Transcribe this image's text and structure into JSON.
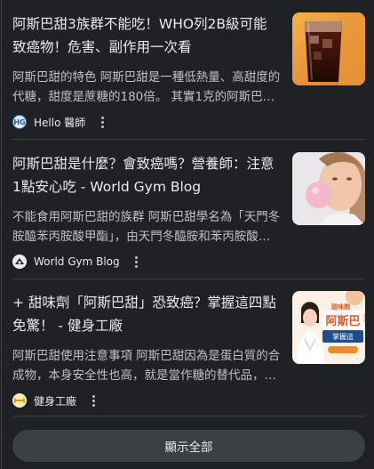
{
  "articles": [
    {
      "title": "阿斯巴甜3族群不能吃！WHO列2B級可能致癌物！危害、副作用一次看",
      "snippet": "阿斯巴甜的特色 阿斯巴甜是一種低熱量、高甜度的代糖，甜度是蔗糖的180倍。 其實1克的阿斯巴甜…",
      "source": "Hello 醫師",
      "favicon_text": "HG",
      "thumb_icon": "soda-glass-image"
    },
    {
      "title": "阿斯巴甜是什麼？會致癌嗎？營養師：注意1點安心吃 - World Gym Blog",
      "snippet": "不能食用阿斯巴甜的族群 阿斯巴甜學名為「天門冬胺醯苯丙胺酸甲酯」，由天門冬醯胺和苯丙胺酸…",
      "source": "World Gym Blog",
      "favicon_text": "",
      "thumb_icon": "bubble-gum-woman-image"
    },
    {
      "title": "+ 甜味劑「阿斯巴甜」恐致癌？掌握這四點免驚！ - 健身工廠",
      "snippet": "阿斯巴甜使用注意事項 阿斯巴甜因為是蛋白質的合成物，本身安全性也高，就是當作糖的替代品，…",
      "source": "健身工廠",
      "favicon_text": "",
      "thumb_icon": "promo-banner-image",
      "thumb_text_main": "阿斯巴",
      "thumb_text_tag": "甜味劑",
      "thumb_text_sub": "掌握這"
    }
  ],
  "show_all_label": "顯示全部"
}
